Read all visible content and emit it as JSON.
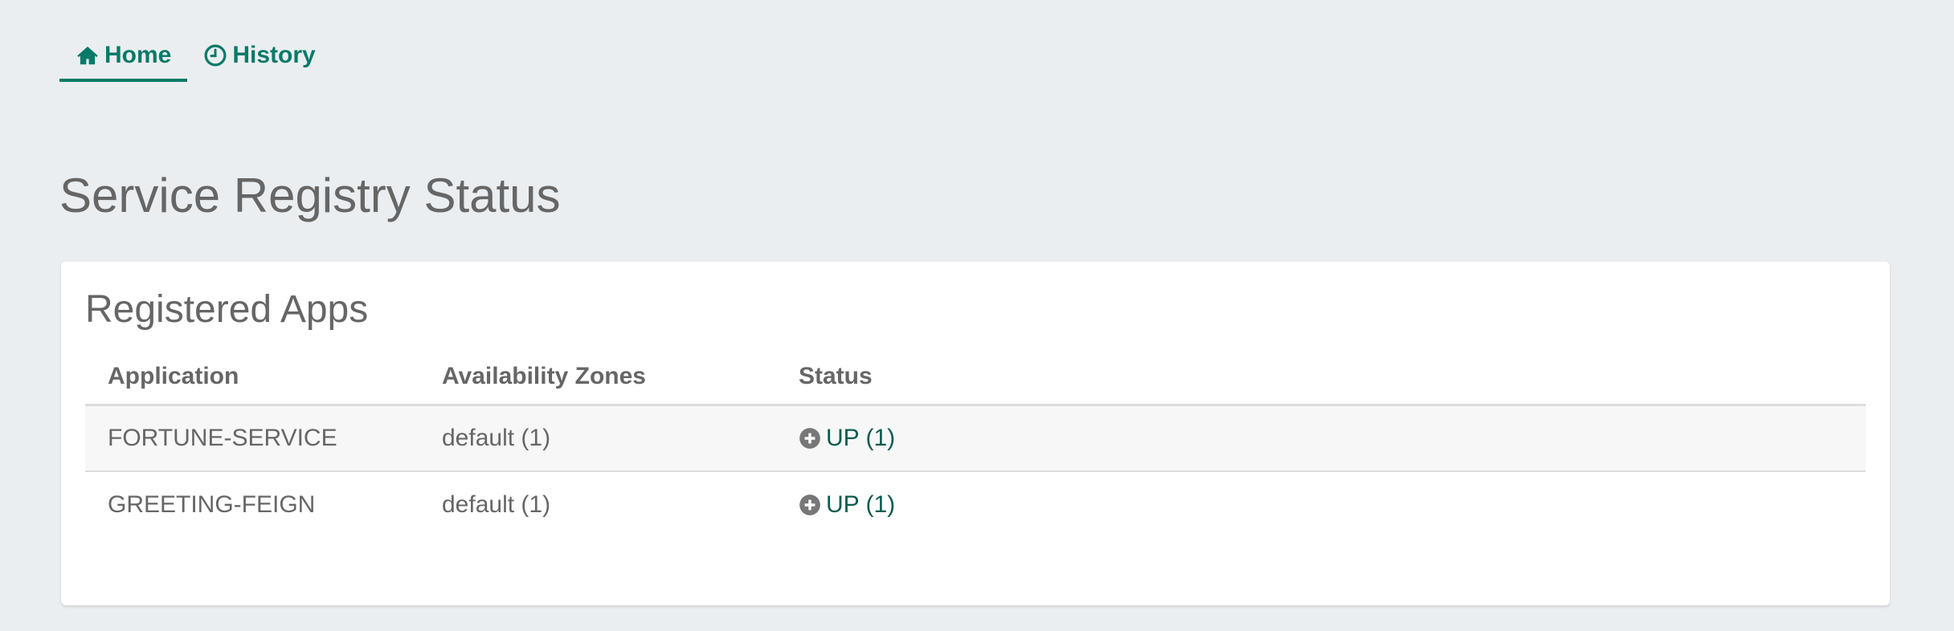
{
  "nav": {
    "tabs": [
      {
        "label": "Home",
        "icon": "home-icon",
        "active": true
      },
      {
        "label": "History",
        "icon": "clock-icon",
        "active": false
      }
    ]
  },
  "page": {
    "title": "Service Registry Status"
  },
  "registered_apps": {
    "title": "Registered Apps",
    "columns": [
      "Application",
      "Availability Zones",
      "Status"
    ],
    "rows": [
      {
        "application": "FORTUNE-SERVICE",
        "zones": "default (1)",
        "status": "UP (1)",
        "status_icon": "plus-circle-icon"
      },
      {
        "application": "GREETING-FEIGN",
        "zones": "default (1)",
        "status": "UP (1)",
        "status_icon": "plus-circle-icon"
      }
    ]
  },
  "colors": {
    "accent": "#087a69",
    "background": "#ebeef0",
    "text": "#666666",
    "status_text": "#0b5c4f"
  }
}
